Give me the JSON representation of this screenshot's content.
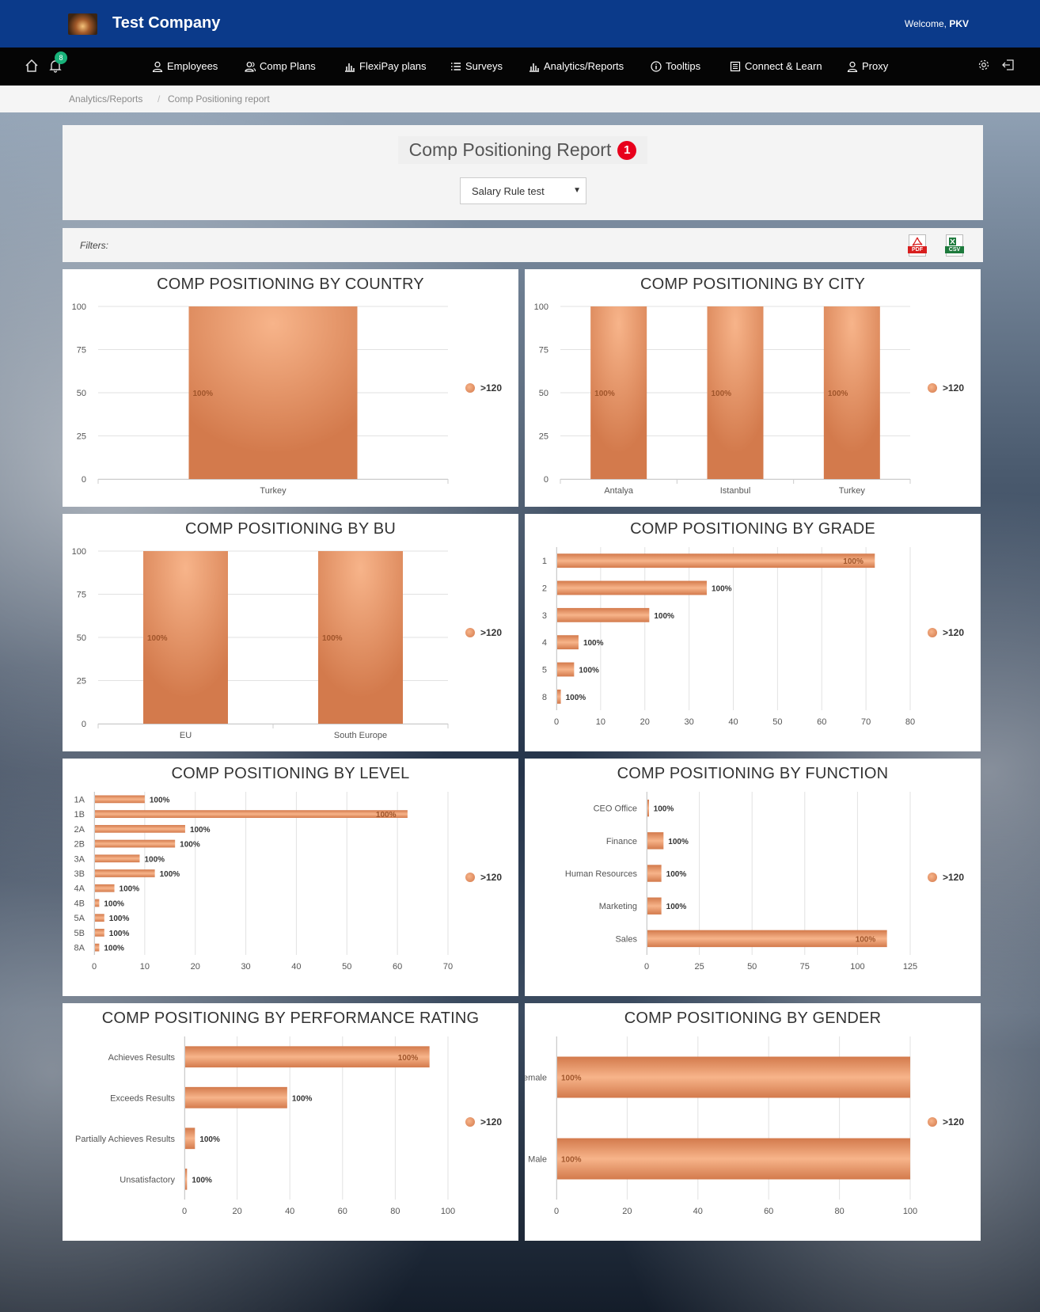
{
  "header": {
    "company": "Test Company",
    "welcome_prefix": "Welcome,",
    "welcome_user": "PKV"
  },
  "nav": {
    "notification_count": "8",
    "items": [
      {
        "label": "Employees",
        "icon": "user-icon"
      },
      {
        "label": "Comp Plans",
        "icon": "users-icon"
      },
      {
        "label": "FlexiPay plans",
        "icon": "bar-chart-icon"
      },
      {
        "label": "Surveys",
        "icon": "list-icon"
      },
      {
        "label": "Analytics/Reports",
        "icon": "bar-chart-icon"
      },
      {
        "label": "Tooltips",
        "icon": "info-icon"
      },
      {
        "label": "Connect & Learn",
        "icon": "book-icon"
      },
      {
        "label": "Proxy",
        "icon": "user-icon"
      }
    ]
  },
  "breadcrumb": {
    "parent": "Analytics/Reports",
    "separator": "/",
    "current": "Comp Positioning report"
  },
  "page": {
    "title": "Comp Positioning Report",
    "title_badge": "1",
    "select_value": "Salary Rule test",
    "filters_label": "Filters:",
    "pdf_label": "PDF",
    "csv_label": "CSV"
  },
  "colors": {
    "header": "#0b3a8a",
    "bar": "#e39468",
    "bar_light": "#f7b48a",
    "bar_dark": "#d37a4c"
  },
  "chart_data": [
    {
      "type": "bar",
      "orientation": "vertical",
      "title": "COMP POSITIONING BY COUNTRY",
      "categories": [
        "Turkey"
      ],
      "series": [
        {
          "name": ">120",
          "values": [
            100
          ],
          "labels": [
            "100%"
          ]
        }
      ],
      "ylim": [
        0,
        100
      ],
      "yticks": [
        "0",
        "25",
        "50",
        "75",
        "100"
      ],
      "legend": "right"
    },
    {
      "type": "bar",
      "orientation": "vertical",
      "title": "COMP POSITIONING BY CITY",
      "categories": [
        "Antalya",
        "Istanbul",
        "Turkey"
      ],
      "series": [
        {
          "name": ">120",
          "values": [
            100,
            100,
            100
          ],
          "labels": [
            "100%",
            "100%",
            "100%"
          ]
        }
      ],
      "ylim": [
        0,
        100
      ],
      "yticks": [
        "0",
        "25",
        "50",
        "75",
        "100"
      ],
      "legend": "right"
    },
    {
      "type": "bar",
      "orientation": "vertical",
      "title": "COMP POSITIONING BY BU",
      "categories": [
        "EU",
        "South Europe"
      ],
      "series": [
        {
          "name": ">120",
          "values": [
            100,
            100
          ],
          "labels": [
            "100%",
            "100%"
          ]
        }
      ],
      "ylim": [
        0,
        100
      ],
      "yticks": [
        "0",
        "25",
        "50",
        "75",
        "100"
      ],
      "legend": "right"
    },
    {
      "type": "bar",
      "orientation": "horizontal",
      "title": "COMP POSITIONING BY GRADE",
      "categories": [
        "1",
        "2",
        "3",
        "4",
        "5",
        "8"
      ],
      "series": [
        {
          "name": ">120",
          "values": [
            72,
            34,
            21,
            5,
            4,
            1
          ],
          "labels": [
            "100%",
            "100%",
            "100%",
            "100%",
            "100%",
            "100%"
          ]
        }
      ],
      "xlim": [
        0,
        80
      ],
      "xticks": [
        "0",
        "10",
        "20",
        "30",
        "40",
        "50",
        "60",
        "70",
        "80"
      ],
      "legend": "right"
    },
    {
      "type": "bar",
      "orientation": "horizontal",
      "title": "COMP POSITIONING BY LEVEL",
      "categories": [
        "1A",
        "1B",
        "2A",
        "2B",
        "3A",
        "3B",
        "4A",
        "4B",
        "5A",
        "5B",
        "8A"
      ],
      "series": [
        {
          "name": ">120",
          "values": [
            10,
            62,
            18,
            16,
            9,
            12,
            4,
            1,
            2,
            2,
            1
          ],
          "labels": [
            "100%",
            "100%",
            "100%",
            "100%",
            "100%",
            "100%",
            "100%",
            "100%",
            "100%",
            "100%",
            "100%"
          ]
        }
      ],
      "xlim": [
        0,
        70
      ],
      "xticks": [
        "0",
        "10",
        "20",
        "30",
        "40",
        "50",
        "60",
        "70"
      ],
      "legend": "right"
    },
    {
      "type": "bar",
      "orientation": "horizontal",
      "title": "COMP POSITIONING BY FUNCTION",
      "categories": [
        "CEO Office",
        "Finance",
        "Human Resources",
        "Marketing",
        "Sales"
      ],
      "series": [
        {
          "name": ">120",
          "values": [
            1,
            8,
            7,
            7,
            114
          ],
          "labels": [
            "100%",
            "100%",
            "100%",
            "100%",
            "100%"
          ]
        }
      ],
      "xlim": [
        0,
        125
      ],
      "xticks": [
        "0",
        "25",
        "50",
        "75",
        "100",
        "125"
      ],
      "legend": "right"
    },
    {
      "type": "bar",
      "orientation": "horizontal",
      "title": "COMP POSITIONING BY PERFORMANCE RATING",
      "categories": [
        "Achieves Results",
        "Exceeds Results",
        "Partially Achieves Results",
        "Unsatisfactory"
      ],
      "series": [
        {
          "name": ">120",
          "values": [
            93,
            39,
            4,
            1
          ],
          "labels": [
            "100%",
            "100%",
            "100%",
            "100%"
          ]
        }
      ],
      "xlim": [
        0,
        100
      ],
      "xticks": [
        "0",
        "20",
        "40",
        "60",
        "80",
        "100"
      ],
      "legend": "right"
    },
    {
      "type": "bar",
      "orientation": "horizontal",
      "title": "COMP POSITIONING BY GENDER",
      "categories": [
        "Female",
        "Male"
      ],
      "series": [
        {
          "name": ">120",
          "values": [
            100,
            100
          ],
          "labels": [
            "100%",
            "100%"
          ]
        }
      ],
      "xlim": [
        0,
        100
      ],
      "xticks": [
        "0",
        "20",
        "40",
        "60",
        "80",
        "100"
      ],
      "legend": "right"
    }
  ]
}
